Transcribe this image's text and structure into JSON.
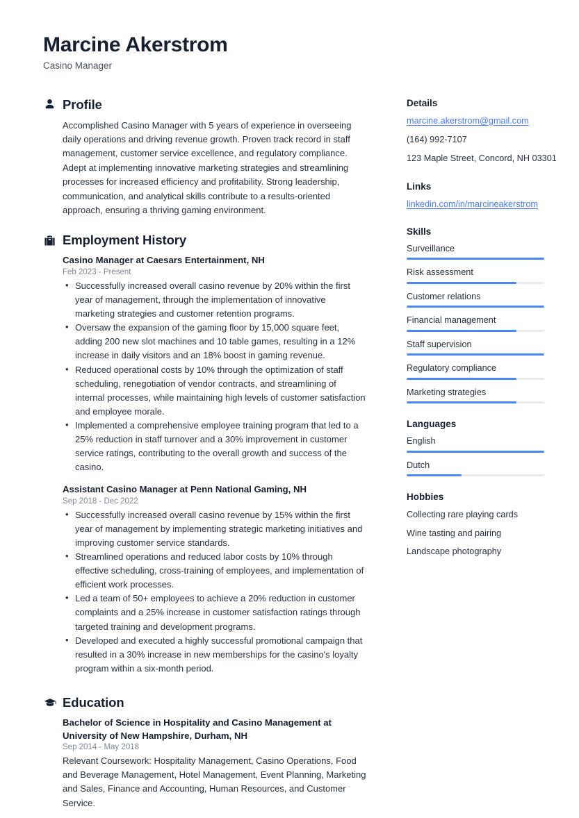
{
  "header": {
    "full_name": "Marcine Akerstrom",
    "job_title": "Casino Manager"
  },
  "colors": {
    "accent_blue": "#4a87f5",
    "link_blue": "#4a7bec",
    "heading_dark": "#17202e",
    "body_text": "#262f3d",
    "muted_date": "#7e8794",
    "meter_track": "#e9eaec"
  },
  "sections": {
    "profile": {
      "icon": "person-icon",
      "title": "Profile",
      "text": "Accomplished Casino Manager with 5 years of experience in overseeing daily operations and driving revenue growth. Proven track record in staff management, customer service excellence, and regulatory compliance. Adept at implementing innovative marketing strategies and streamlining processes for increased efficiency and profitability. Strong leadership, communication, and analytical skills contribute to a results-oriented approach, ensuring a thriving gaming environment."
    },
    "employment": {
      "icon": "briefcase-icon",
      "title": "Employment History",
      "entries": [
        {
          "title": "Casino Manager at Caesars Entertainment, NH",
          "date": "Feb 2023 - Present",
          "bullets": [
            "Successfully increased overall casino revenue by 20% within the first year of management, through the implementation of innovative marketing strategies and customer retention programs.",
            "Oversaw the expansion of the gaming floor by 15,000 square feet, adding 200 new slot machines and 10 table games, resulting in a 12% increase in daily visitors and an 18% boost in gaming revenue.",
            "Reduced operational costs by 10% through the optimization of staff scheduling, renegotiation of vendor contracts, and streamlining of internal processes, while maintaining high levels of customer satisfaction and employee morale.",
            "Implemented a comprehensive employee training program that led to a 25% reduction in staff turnover and a 30% improvement in customer service ratings, contributing to the overall growth and success of the casino."
          ]
        },
        {
          "title": "Assistant Casino Manager at Penn National Gaming, NH",
          "date": "Sep 2018 - Dec 2022",
          "bullets": [
            "Successfully increased overall casino revenue by 15% within the first year of management by implementing strategic marketing initiatives and improving customer service standards.",
            "Streamlined operations and reduced labor costs by 10% through effective scheduling, cross-training of employees, and implementation of efficient work processes.",
            "Led a team of 50+ employees to achieve a 20% reduction in customer complaints and a 25% increase in customer satisfaction ratings through targeted training and development programs.",
            "Developed and executed a highly successful promotional campaign that resulted in a 30% increase in new memberships for the casino's loyalty program within a six-month period."
          ]
        }
      ]
    },
    "education": {
      "icon": "graduation-cap-icon",
      "title": "Education",
      "entries": [
        {
          "title": "Bachelor of Science in Hospitality and Casino Management at University of New Hampshire, Durham, NH",
          "date": "Sep 2014 - May 2018",
          "description": "Relevant Coursework: Hospitality Management, Casino Operations, Food and Beverage Management, Hotel Management, Event Planning, Marketing and Sales, Finance and Accounting, Human Resources, and Customer Service."
        }
      ]
    }
  },
  "sidebar": {
    "details": {
      "title": "Details",
      "email": "marcine.akerstrom@gmail.com",
      "phone": "(164) 992-7107",
      "address": "123 Maple Street, Concord, NH 03301"
    },
    "links": {
      "title": "Links",
      "items": [
        {
          "label": "linkedin.com/in/marcineakerstrom"
        }
      ]
    },
    "skills": {
      "title": "Skills",
      "items": [
        {
          "label": "Surveillance",
          "level": 100
        },
        {
          "label": "Risk assessment",
          "level": 80
        },
        {
          "label": "Customer relations",
          "level": 100
        },
        {
          "label": "Financial management",
          "level": 80
        },
        {
          "label": "Staff supervision",
          "level": 100
        },
        {
          "label": "Regulatory compliance",
          "level": 80
        },
        {
          "label": "Marketing strategies",
          "level": 80
        }
      ]
    },
    "languages": {
      "title": "Languages",
      "items": [
        {
          "label": "English",
          "level": 100
        },
        {
          "label": "Dutch",
          "level": 40
        }
      ]
    },
    "hobbies": {
      "title": "Hobbies",
      "items": [
        {
          "label": "Collecting rare playing cards"
        },
        {
          "label": "Wine tasting and pairing"
        },
        {
          "label": "Landscape photography"
        }
      ]
    }
  }
}
